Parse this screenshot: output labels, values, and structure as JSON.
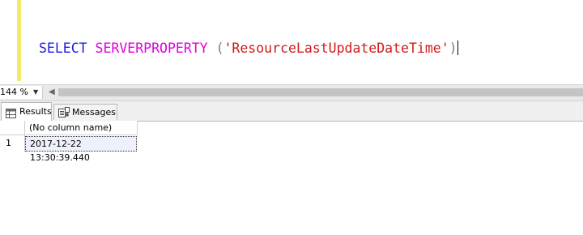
{
  "editor": {
    "query": {
      "keyword": "SELECT",
      "function": "SERVERPROPERTY",
      "open_paren": "(",
      "string_literal": "'ResourceLastUpdateDateTime'",
      "close_paren": ")"
    }
  },
  "status_strip": {
    "zoom_value": "144 %"
  },
  "tabs": [
    {
      "label": "Results",
      "icon": "grid-icon",
      "active": true
    },
    {
      "label": "Messages",
      "icon": "messages-icon",
      "active": false
    }
  ],
  "results": {
    "columns": [
      "(No column name)"
    ],
    "rows": [
      {
        "row_number": "1",
        "values": [
          "2017-12-22 13:30:39.440"
        ]
      }
    ]
  },
  "colors": {
    "keyword": "#1c1ce0",
    "function": "#e000e0",
    "string": "#d11a1a",
    "change_bar": "#f5e96a"
  }
}
